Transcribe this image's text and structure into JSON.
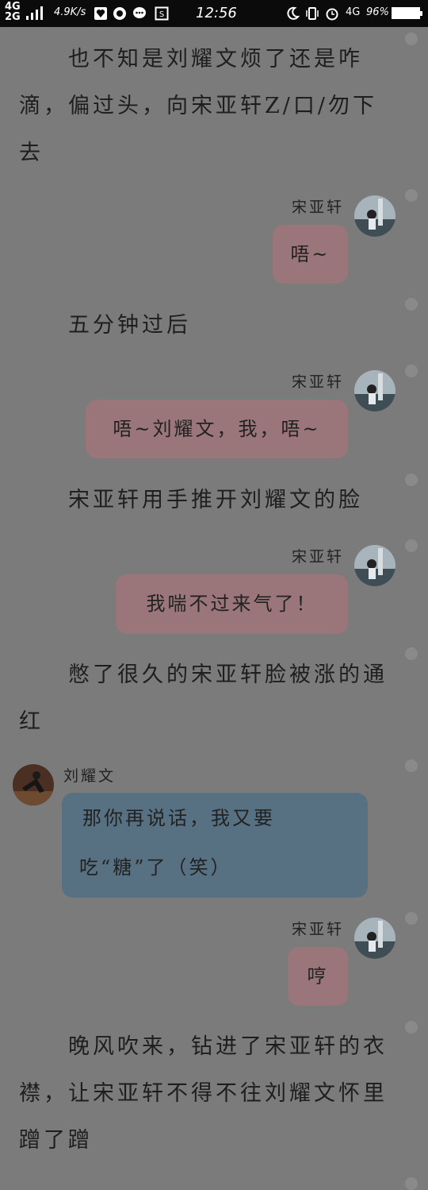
{
  "status_bar": {
    "network_top": "4G",
    "network_bottom": "2G",
    "speed": "4.9K/s",
    "time": "12:56",
    "right_network": "4G",
    "battery": "96%"
  },
  "story": {
    "p1": "也不知是刘耀文烦了还是咋滴，偏过头，向宋亚轩Z/口/勿下去",
    "p2": "五分钟过后",
    "p3": "宋亚轩用手推开刘耀文的脸",
    "p4": "憋了很久的宋亚轩脸被涨的通红",
    "p5": "晚风吹来，钻进了宋亚轩的衣襟，让宋亚轩不得不往刘耀文怀里蹭了蹭"
  },
  "messages": [
    {
      "speaker": "宋亚轩",
      "text": "唔~"
    },
    {
      "speaker": "宋亚轩",
      "text": "唔~刘耀文，我，唔~"
    },
    {
      "speaker": "宋亚轩",
      "text": "我喘不过来气了！"
    },
    {
      "speaker": "刘耀文",
      "line1": "那你再说话，我又要",
      "line2": "吃“糖”了（笑）"
    },
    {
      "speaker": "宋亚轩",
      "text": "哼"
    }
  ],
  "colors": {
    "background": "#7b7b7b",
    "right_bubble": "#9a7579",
    "left_bubble": "#577182",
    "status_bar": "#0b0b0b"
  }
}
